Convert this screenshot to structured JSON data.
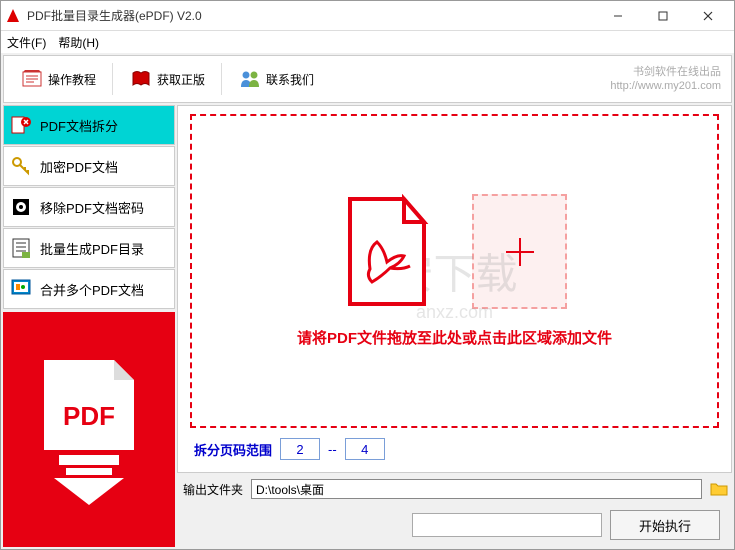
{
  "window": {
    "title": "PDF批量目录生成器(ePDF) V2.0"
  },
  "menu": {
    "file": "文件(F)",
    "help": "帮助(H)"
  },
  "toolbar": {
    "tutorial": "操作教程",
    "getGenuine": "获取正版",
    "contact": "联系我们",
    "brand1": "书剑软件在线出品",
    "brand2": "http://www.my201.com"
  },
  "sidebar": {
    "items": [
      {
        "label": "PDF文档拆分"
      },
      {
        "label": "加密PDF文档"
      },
      {
        "label": "移除PDF文档密码"
      },
      {
        "label": "批量生成PDF目录"
      },
      {
        "label": "合并多个PDF文档"
      }
    ]
  },
  "dropzone": {
    "text": "请将PDF文件拖放至此处或点击此区域添加文件"
  },
  "range": {
    "label": "拆分页码范围",
    "from": "2",
    "to": "4"
  },
  "output": {
    "label": "输出文件夹",
    "value": "D:\\tools\\桌面"
  },
  "execute": {
    "label": "开始执行"
  },
  "watermark": {
    "main": "安下载",
    "sub": "anxz.com"
  }
}
